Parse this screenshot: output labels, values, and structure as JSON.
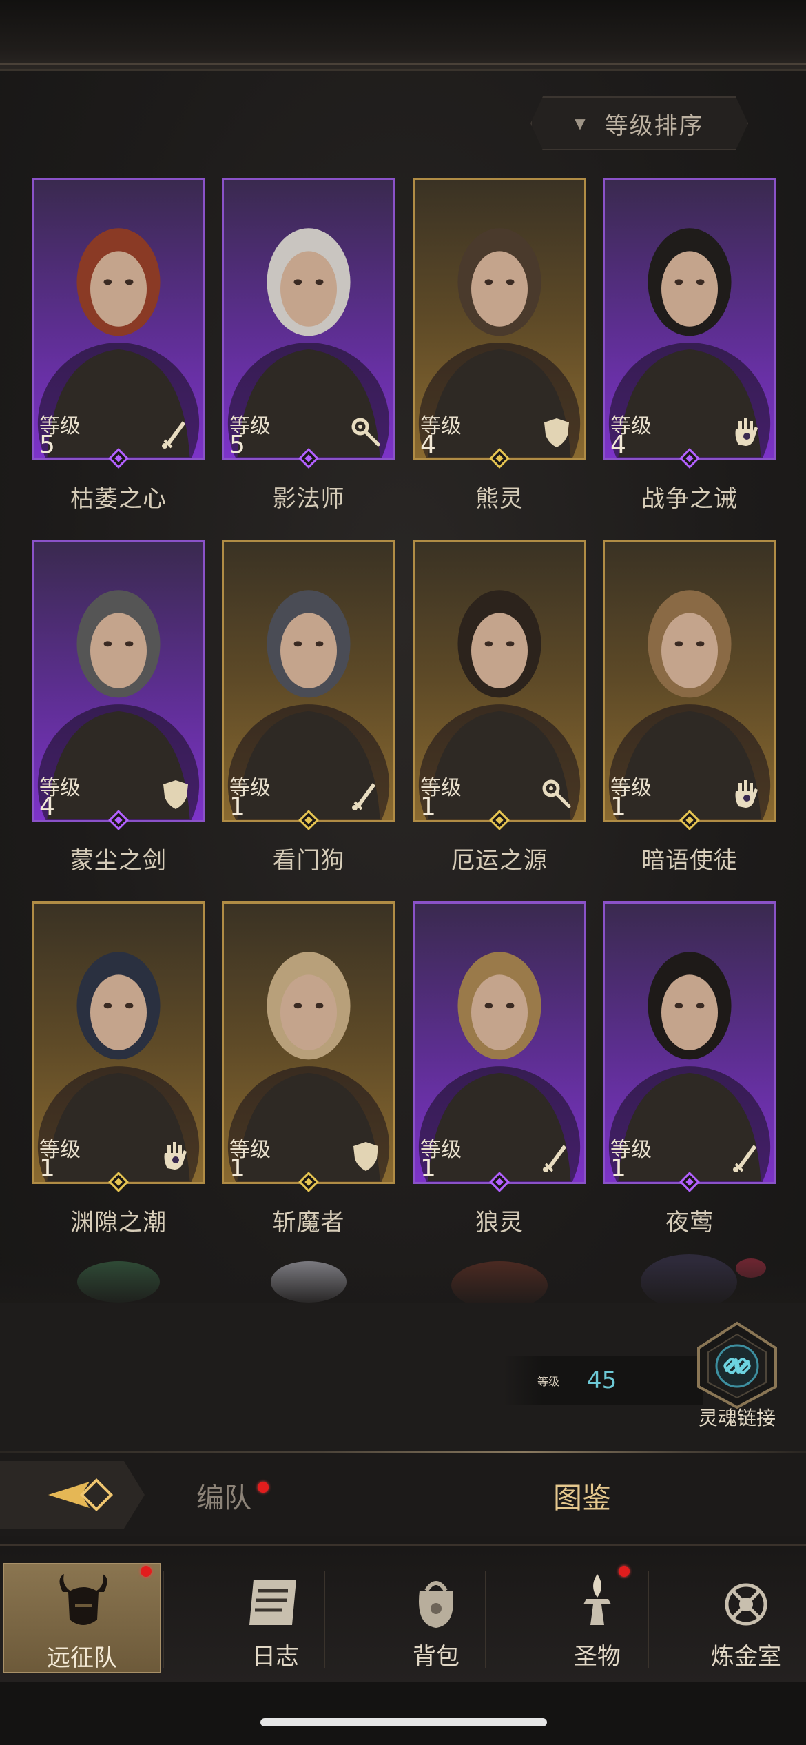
{
  "sort": {
    "label": "等级排序"
  },
  "level_word": "等级",
  "heroes": [
    {
      "name": "枯萎之心",
      "level": "5",
      "rarity": "purple",
      "role": "sword-icon",
      "hair": "#8a3a25"
    },
    {
      "name": "影法师",
      "level": "5",
      "rarity": "purple",
      "role": "staff-icon",
      "hair": "#c9c5c0"
    },
    {
      "name": "熊灵",
      "level": "4",
      "rarity": "gold",
      "role": "shield-icon",
      "hair": "#4a3a2c"
    },
    {
      "name": "战争之诫",
      "level": "4",
      "rarity": "purple",
      "role": "hand-icon",
      "hair": "#1f1c1a"
    },
    {
      "name": "蒙尘之剑",
      "level": "4",
      "rarity": "purple",
      "role": "shield-icon",
      "hair": "#555555"
    },
    {
      "name": "看门狗",
      "level": "1",
      "rarity": "gold",
      "role": "sword-icon",
      "hair": "#4a4c55"
    },
    {
      "name": "厄运之源",
      "level": "1",
      "rarity": "gold",
      "role": "staff-icon",
      "hair": "#2c231c"
    },
    {
      "name": "暗语使徒",
      "level": "1",
      "rarity": "gold",
      "role": "hand-icon",
      "hair": "#8a6a45"
    },
    {
      "name": "渊隙之潮",
      "level": "1",
      "rarity": "gold",
      "role": "hand-icon",
      "hair": "#2a3040"
    },
    {
      "name": "斩魔者",
      "level": "1",
      "rarity": "gold",
      "role": "shield-icon",
      "hair": "#b8a07a"
    },
    {
      "name": "狼灵",
      "level": "1",
      "rarity": "purple",
      "role": "sword-icon",
      "hair": "#9a7a4a"
    },
    {
      "name": "夜莺",
      "level": "1",
      "rarity": "purple",
      "role": "sword-icon",
      "hair": "#1e1a18"
    }
  ],
  "player": {
    "level_label": "等级",
    "level_value": "45"
  },
  "soul_link": {
    "label": "灵魂链接"
  },
  "tabs": {
    "formation": "编队",
    "codex": "图鉴"
  },
  "nav": [
    {
      "label": "远征队",
      "icon": "horned-helmet-icon",
      "active": true
    },
    {
      "label": "日志",
      "icon": "scroll-icon",
      "active": false
    },
    {
      "label": "背包",
      "icon": "bag-icon",
      "active": false
    },
    {
      "label": "圣物",
      "icon": "relic-icon",
      "active": false
    },
    {
      "label": "炼金室",
      "icon": "alchemy-icon",
      "active": false
    }
  ],
  "colors": {
    "purple": "#7d33c9",
    "gold": "#8a6a30",
    "accent_cyan": "#6dc9d6",
    "notification": "#e21d1d"
  }
}
